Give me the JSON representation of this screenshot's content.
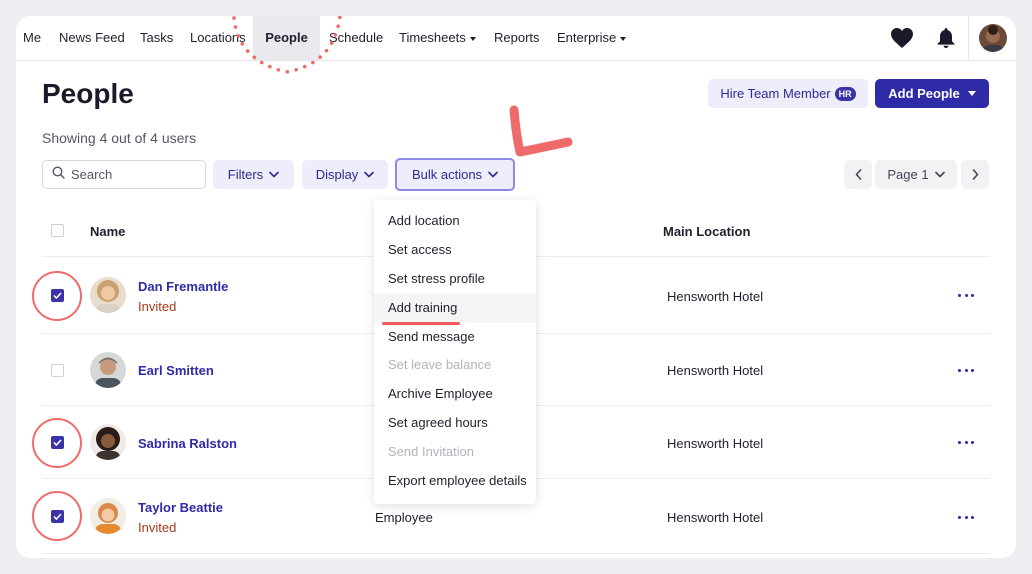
{
  "nav": {
    "items": [
      "Me",
      "News Feed",
      "Tasks",
      "Locations",
      "People",
      "Schedule",
      "Timesheets",
      "Reports",
      "Enterprise"
    ],
    "active": "People"
  },
  "header": {
    "title": "People",
    "hire_label": "Hire Team Member",
    "hr_badge": "HR",
    "add_label": "Add People",
    "showing": "Showing 4 out of 4 users"
  },
  "toolbar": {
    "search_placeholder": "Search",
    "filters": "Filters",
    "display": "Display",
    "bulk": "Bulk actions",
    "page": "Page 1"
  },
  "table": {
    "col_name": "Name",
    "col_location": "Main Location",
    "rows": [
      {
        "name": "Dan Fremantle",
        "status": "Invited",
        "role": "",
        "location": "Hensworth Hotel",
        "checked": true
      },
      {
        "name": "Earl Smitten",
        "status": "",
        "role": "",
        "location": "Hensworth Hotel",
        "checked": false
      },
      {
        "name": "Sabrina Ralston",
        "status": "",
        "role": "",
        "location": "Hensworth Hotel",
        "checked": true
      },
      {
        "name": "Taylor Beattie",
        "status": "Invited",
        "role": "Employee",
        "location": "Hensworth Hotel",
        "checked": true
      }
    ]
  },
  "menu": {
    "items": [
      {
        "label": "Add location",
        "disabled": false
      },
      {
        "label": "Set access",
        "disabled": false
      },
      {
        "label": "Set stress profile",
        "disabled": false
      },
      {
        "label": "Add training",
        "disabled": false
      },
      {
        "label": "Send message",
        "disabled": false
      },
      {
        "label": "Set leave balance",
        "disabled": true
      },
      {
        "label": "Archive Employee",
        "disabled": false
      },
      {
        "label": "Set agreed hours",
        "disabled": false
      },
      {
        "label": "Send Invitation",
        "disabled": true
      },
      {
        "label": "Export employee details",
        "disabled": false
      }
    ]
  },
  "colors": {
    "accent": "#2f2aa6",
    "annotation": "#ef6b6b",
    "invited": "#a33a1c"
  }
}
